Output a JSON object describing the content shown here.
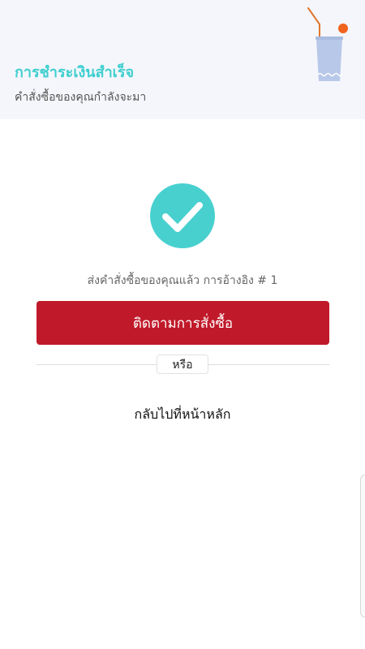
{
  "header": {
    "title": "การชำระเงินสำเร็จ",
    "subtitle": "คำสั่งซื้อของคุณกำลังจะมา",
    "illustration_icon": "drink-glass-icon"
  },
  "main": {
    "status_icon": "check-circle-icon",
    "order_reference_text": "ส่งคำสั่งซื้อของคุณแล้ว การอ้างอิง # 1",
    "track_order_label": "ติดตามการสั่งซื้อ",
    "or_label": "หรือ",
    "back_home_label": "กลับไปที่หน้าหลัก"
  },
  "colors": {
    "accent": "#3fcfcf",
    "primary": "#c01a2a",
    "header_bg": "#f4f6fb"
  }
}
